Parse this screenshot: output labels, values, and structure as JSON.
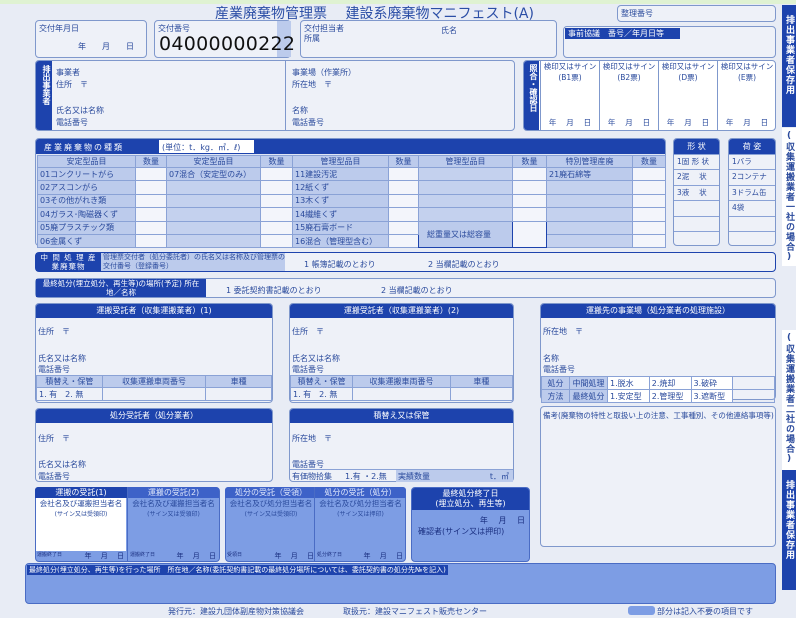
{
  "title": "産業廃棄物管理票　 建設系廃棄物マニフェスト(A)",
  "header": {
    "seiri_label": "整理番号",
    "issue_date_label": "交付年月日",
    "issue_date_units": "年　　月　　日",
    "issue_no_label": "交付番号",
    "issue_no": "04000000222",
    "staff_label": "交付担当者",
    "staff_dept": "所属",
    "staff_name": "氏名",
    "prior_label": "事前協議　番号／年月日等"
  },
  "side_tabs": {
    "top": "排出事業者保存用",
    "mid1": "(収集運搬業者一社の場合)",
    "mid2": "(収集運搬業者二社の場合)",
    "bottom": "排出事業者保存用"
  },
  "emitter": {
    "label": "排出事業者",
    "company": "事業者",
    "address": "住所　〒",
    "name": "氏名又は名称",
    "phone": "電話番号",
    "site": "事業場（作業所）",
    "site_addr": "所在地　〒",
    "site_name": "名称",
    "site_phone": "電話番号"
  },
  "check": {
    "label": "照合・確認日",
    "cols": [
      {
        "title": "検印又はサイン",
        "sub": "(B1票)"
      },
      {
        "title": "検印又はサイン",
        "sub": "(B2票)"
      },
      {
        "title": "検印又はサイン",
        "sub": "(D票)"
      },
      {
        "title": "検印又はサイン",
        "sub": "(E票)"
      }
    ],
    "date": "年　 月　 日"
  },
  "waste": {
    "title": "産業廃棄物の種類",
    "unit": "(単位：t．kg．㎥．ℓ)",
    "headers": [
      "安定型品目",
      "数量",
      "安定型品目",
      "数量",
      "管理型品目",
      "数量",
      "管理型品目",
      "数量",
      "特別管理産廃",
      "数量"
    ],
    "rows": [
      [
        "01コンクリートがら",
        "",
        "07混合（安定型のみ）",
        "",
        "11建設汚泥",
        "",
        "",
        "",
        "21廃石綿等",
        ""
      ],
      [
        "02アスコンがら",
        "",
        "",
        "",
        "12紙くず",
        "",
        "",
        "",
        "",
        ""
      ],
      [
        "03その他がれき類",
        "",
        "",
        "",
        "13木くず",
        "",
        "",
        "",
        "",
        ""
      ],
      [
        "04ガラス･陶磁器くず",
        "",
        "",
        "",
        "14繊維くず",
        "",
        "",
        "",
        "",
        ""
      ],
      [
        "05廃プラスチック類",
        "",
        "",
        "",
        "15廃石膏ボード",
        "",
        "総重量又は総容量",
        "",
        "",
        ""
      ],
      [
        "06金属くず",
        "",
        "",
        "",
        "16混合（管理型含む）",
        "",
        "",
        "",
        "",
        ""
      ]
    ]
  },
  "shape": {
    "title": "形 状",
    "items": [
      "1固 形 状",
      "2泥　 状",
      "3液　 状",
      "",
      "",
      ""
    ]
  },
  "package": {
    "title": "荷 姿",
    "items": [
      "1バラ",
      "2コンテナ",
      "3ドラム缶",
      "4袋",
      "",
      ""
    ]
  },
  "intermediate": {
    "label": "中 間 処 理 産業廃棄物",
    "desc": "管理票交付者（処分委託者）の氏名又は名称及び管理票の交付番号（登録番号）",
    "opt1": "1 帳簿記載のとおり",
    "opt2": "2 当欄記載のとおり"
  },
  "final_place": {
    "label": "最終処分(埋立処分、再生等)の場所(予定) 所在地／名称",
    "opt1": "1 委託契約書記載のとおり",
    "opt2": "2 当欄記載のとおり"
  },
  "carrier1": {
    "title": "運搬受託者（収集運搬業者）(1)",
    "address": "住所　〒",
    "name": "氏名又は名称",
    "phone": "電話番号",
    "cols": [
      "積替え・保管",
      "収集運搬車両番号",
      "車種"
    ],
    "opt": "1. 有　2. 無"
  },
  "carrier2": {
    "title": "運搬受託者（収集運搬業者）(2)",
    "address": "住所　〒",
    "name": "氏名又は名称",
    "phone": "電話番号",
    "cols": [
      "積替え・保管",
      "収集運搬車両番号",
      "車種"
    ],
    "opt": "1. 有　2. 無"
  },
  "destination": {
    "title": "運搬先の事業場（処分業者の処理施設）",
    "address": "所在地　〒",
    "name": "名称",
    "phone": "電話番号",
    "method1": "処分",
    "method2": "方法",
    "mid": "中間処理",
    "mid_opts": [
      "1.脱水",
      "2.焼却",
      "3.破砕"
    ],
    "fin": "最終処分",
    "fin_opts": [
      "1.安定型",
      "2.管理型",
      "3.遮断型"
    ]
  },
  "disposer": {
    "title": "処分受託者（処分業者）",
    "address": "住所　〒",
    "name": "氏名又は名称",
    "phone": "電話番号"
  },
  "storage": {
    "title": "積替え又は保管",
    "address": "所在地　〒",
    "phone": "電話番号",
    "valuables": "有価物拾集",
    "opt": "1.有 ・2.無",
    "actual": "実績数量",
    "unit": "t．㎥"
  },
  "remarks": {
    "label": "備考(廃棄物の特性と取扱い上の注意、工事種別、その他連絡事項等)"
  },
  "receipts": [
    {
      "title": "運搬の受託(1)",
      "sub": "会社名及び運搬担当者名",
      "note": "(サイン又は受領印)",
      "date_label": "運搬終了日",
      "date": "年　 月　 日"
    },
    {
      "title": "運搬の受託(2)",
      "sub": "会社名及び運搬担当者名",
      "note": "(サイン又は受領印)",
      "date_label": "運搬終了日",
      "date": "年　 月　 日"
    },
    {
      "title": "処分の受託（受領）",
      "sub": "会社名及び処分担当者名",
      "note": "(サイン又は受領印)",
      "date_label": "受領日",
      "date": "年　 月　 日"
    },
    {
      "title": "処分の受託（処分）",
      "sub": "会社名及び処分担当者名",
      "note": "(サイン又は押印)",
      "date_label": "処分終了日",
      "date": "年　 月　 日"
    }
  ],
  "final_end": {
    "title": "最終処分終了日",
    "sub": "(埋立処分、再生等)",
    "date": "年　 月　 日",
    "confirm": "確認者(サイン又は押印)"
  },
  "final_done": {
    "label": "最終処分(埋立処分、再生等)を行った場所　所在地／名称(委託契約書記載の最終処分場所については、委託契約書の処分先№を記入)"
  },
  "footer": {
    "publisher": "発行元：建設九団体副産物対策協議会",
    "distributor": "取扱元：建設マニフェスト販売センター",
    "legend": "部分は記入不要の項目です"
  },
  "colors": {
    "dark": "#1d43ad",
    "light": "#bccbec",
    "medium": "#7d9de4",
    "paper": "#e8ecf5"
  }
}
